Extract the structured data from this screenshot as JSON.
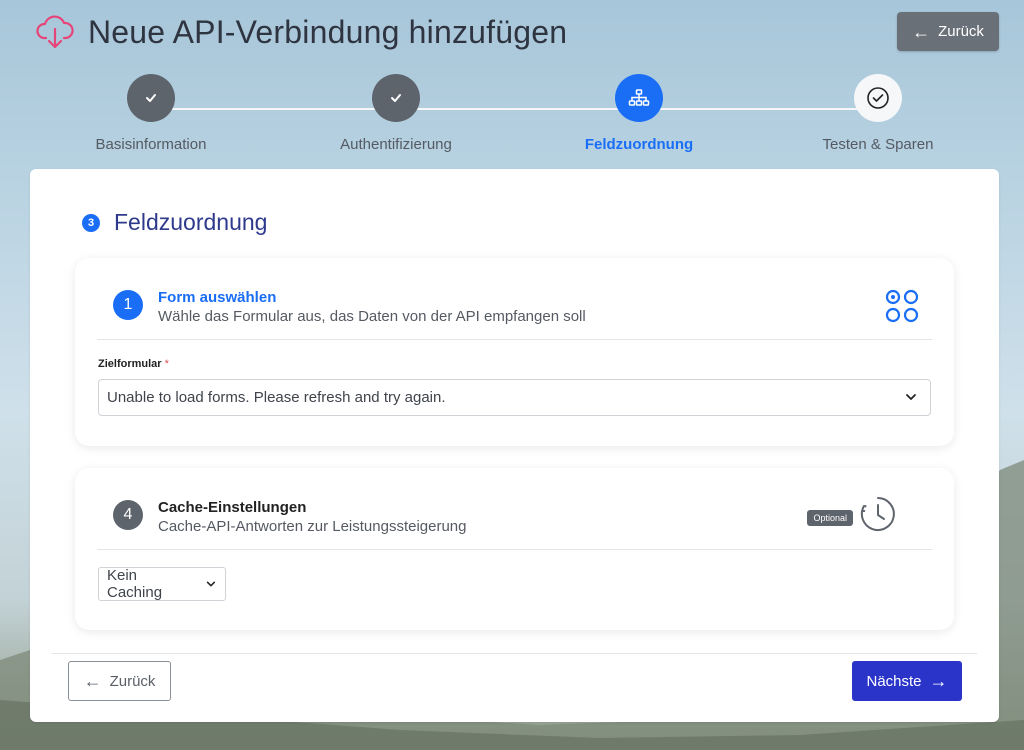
{
  "header": {
    "title": "Neue API-Verbindung hinzufügen",
    "back_label": "Zurück",
    "logo_icon": "cloud-download-icon",
    "accent_color": "#e6457a"
  },
  "stepper": {
    "steps": [
      {
        "label": "Basisinformation",
        "state": "done",
        "icon": "check-icon"
      },
      {
        "label": "Authentifizierung",
        "state": "done",
        "icon": "check-icon"
      },
      {
        "label": "Feldzuordnung",
        "state": "active",
        "icon": "sitemap-icon"
      },
      {
        "label": "Testen & Sparen",
        "state": "todo",
        "icon": "check-circle-icon"
      }
    ]
  },
  "main": {
    "section_number": "3",
    "section_title": "Feldzuordnung",
    "form_panel": {
      "number": "1",
      "heading": "Form auswählen",
      "subheading": "Wähle das Formular aus, das Daten von der API empfangen soll",
      "field_label": "Zielformular",
      "required_mark": "*",
      "select_value": "Unable to load forms. Please refresh and try again."
    },
    "cache_panel": {
      "number": "4",
      "heading": "Cache-Einstellungen",
      "subheading": "Cache-API-Antworten zur Leistungssteigerung",
      "badge": "Optional",
      "select_value": "Kein Caching"
    }
  },
  "footer": {
    "back_label": "Zurück",
    "next_label": "Nächste"
  },
  "colors": {
    "primary": "#1a6ef5",
    "next_button": "#2a34c8",
    "step_done": "#5e646c"
  }
}
